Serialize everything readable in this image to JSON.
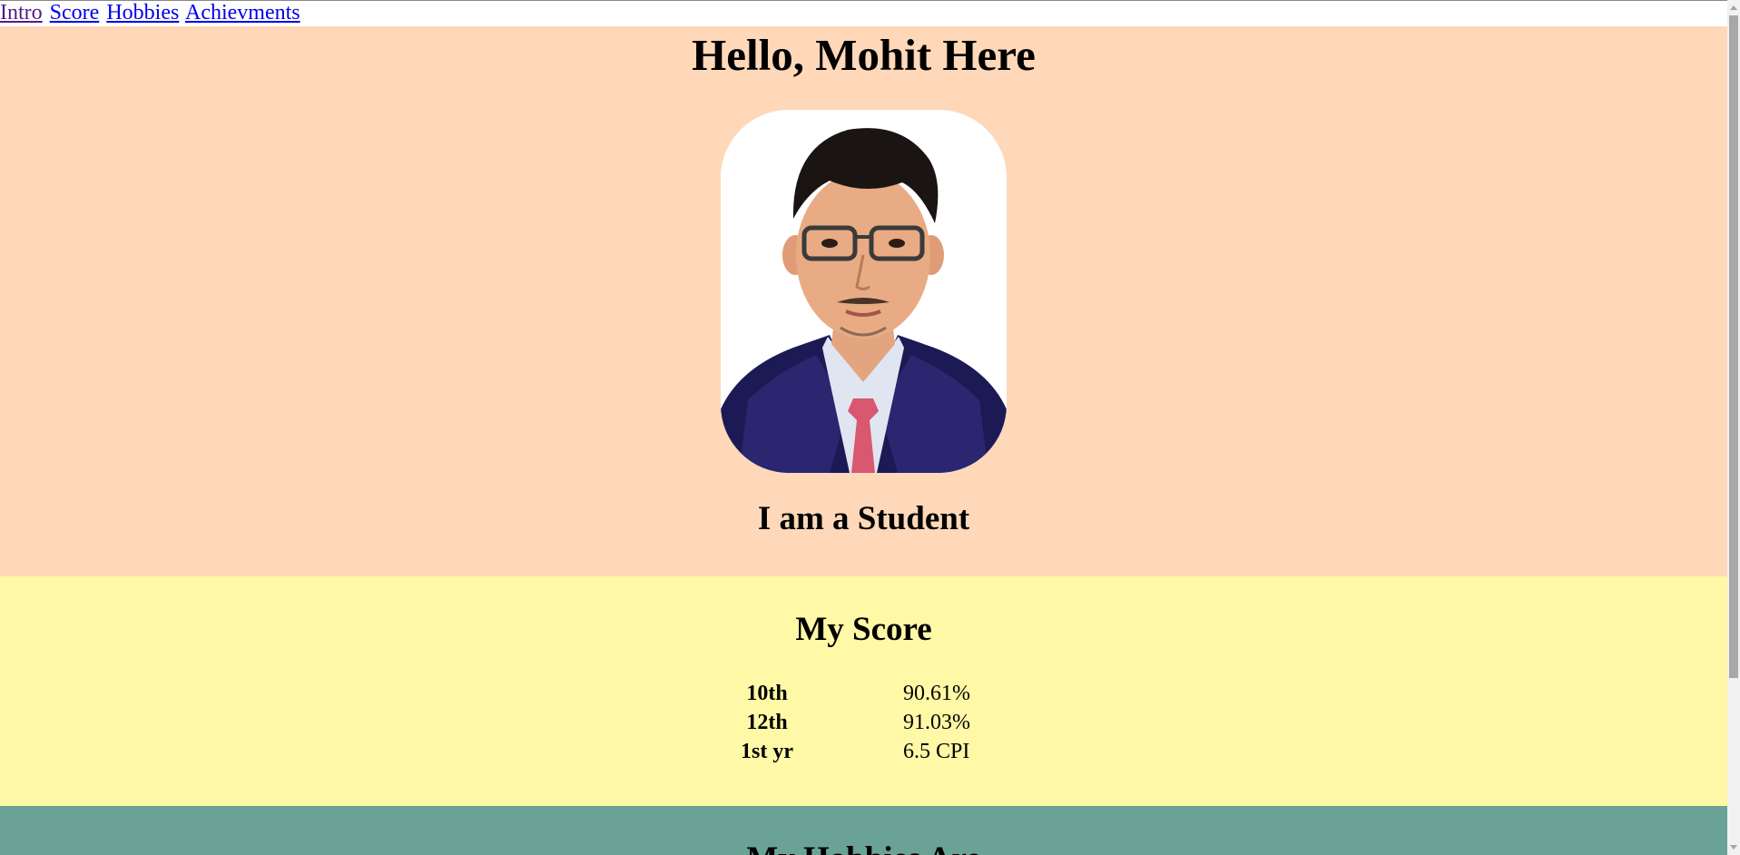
{
  "nav": {
    "links": [
      {
        "label": "Intro"
      },
      {
        "label": "Score"
      },
      {
        "label": "Hobbies"
      },
      {
        "label": "Achievments"
      }
    ]
  },
  "intro": {
    "heading": "Hello, Mohit Here",
    "photo_alt": "profile photo",
    "tagline": "I am a Student"
  },
  "score": {
    "heading": "My Score",
    "rows": [
      {
        "label": "10th",
        "value": "90.61%"
      },
      {
        "label": "12th",
        "value": "91.03%"
      },
      {
        "label": "1st yr",
        "value": "6.5 CPI"
      }
    ]
  },
  "hobbies": {
    "heading": "My Hobbies Are"
  },
  "colors": {
    "intro_bg": "#fed8b9",
    "score_bg": "#fff8a6",
    "hobbies_bg": "#6ba296",
    "link": "#0000ee",
    "visited_link": "#551a8b"
  },
  "icons": {
    "scroll_up": "triangle-up-icon",
    "scroll_down": "triangle-down-icon"
  }
}
